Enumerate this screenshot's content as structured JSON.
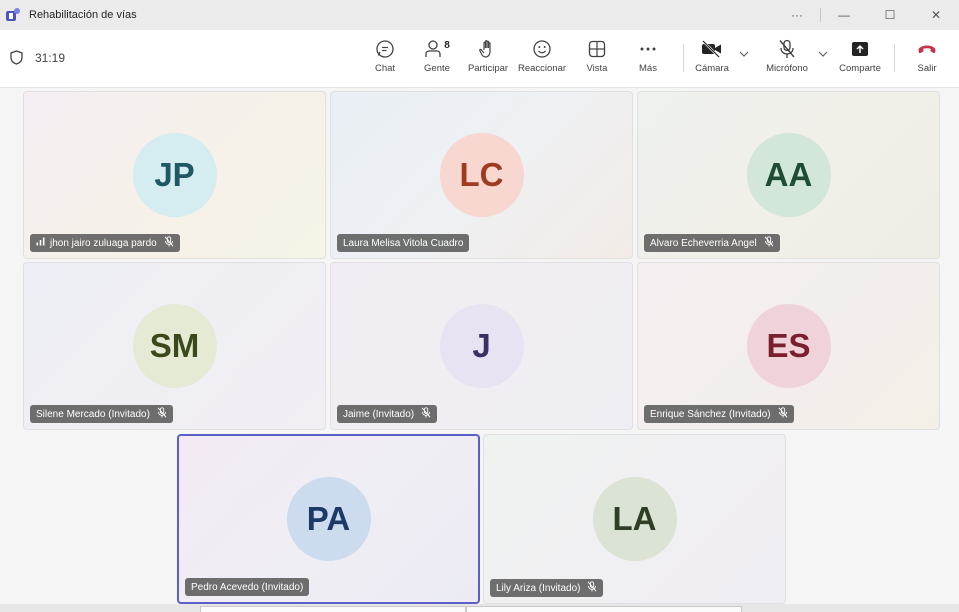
{
  "window": {
    "title": "Rehabilitación de vías",
    "more_label": "···",
    "minimize_label": "—",
    "maximize_label": "☐",
    "close_label": "✕"
  },
  "toolbar": {
    "timer": "31:19",
    "people_count": "8",
    "chat_label": "Chat",
    "people_label": "Gente",
    "raise_hand_label": "Participar",
    "react_label": "Reaccionar",
    "view_label": "Vista",
    "more_label": "Más",
    "camera_label": "Cámara",
    "mic_label": "Micrófono",
    "share_label": "Comparte",
    "leave_label": "Salir",
    "leave_color": "#c4314b"
  },
  "participants": [
    {
      "initials": "JP",
      "name": "jhon jairo zuluaga pardo",
      "muted": true,
      "signal": true,
      "avatar_bg": "#d5ecf0",
      "avatar_fg": "#1d5863"
    },
    {
      "initials": "LC",
      "name": "Laura Melisa Vitola Cuadro",
      "muted": false,
      "signal": false,
      "avatar_bg": "#f7d7cf",
      "avatar_fg": "#a03a20"
    },
    {
      "initials": "AA",
      "name": "Alvaro Echeverria Angel",
      "muted": true,
      "signal": false,
      "avatar_bg": "#d2e6d9",
      "avatar_fg": "#1f4d33"
    },
    {
      "initials": "SM",
      "name": "Silene Mercado (Invitado)",
      "muted": true,
      "signal": false,
      "avatar_bg": "#e4ead4",
      "avatar_fg": "#3b4a1d"
    },
    {
      "initials": "J",
      "name": "Jaime (Invitado)",
      "muted": true,
      "signal": false,
      "avatar_bg": "#e7e3f3",
      "avatar_fg": "#3c2f66"
    },
    {
      "initials": "ES",
      "name": "Enrique Sánchez (Invitado)",
      "muted": true,
      "signal": false,
      "avatar_bg": "#f0d3d8",
      "avatar_fg": "#7a1f2f"
    },
    {
      "initials": "PA",
      "name": "Pedro Acevedo (Invitado)",
      "muted": false,
      "signal": false,
      "avatar_bg": "#cddbef",
      "avatar_fg": "#1d3a66"
    },
    {
      "initials": "LA",
      "name": "Lily Ariza (Invitado)",
      "muted": true,
      "signal": false,
      "avatar_bg": "#dbe3d4",
      "avatar_fg": "#2f3f26"
    }
  ],
  "accent_color": "#5b5fc7"
}
